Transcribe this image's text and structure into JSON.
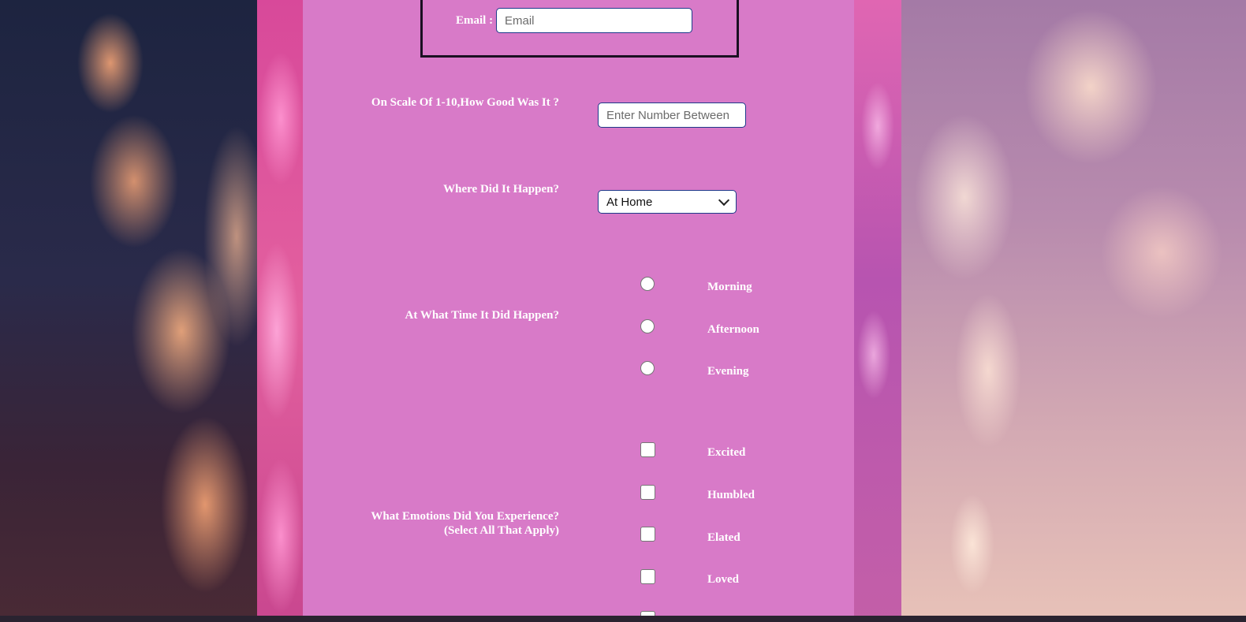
{
  "contact": {
    "email_label": "Email :",
    "email_placeholder": "Email"
  },
  "rating": {
    "label": "On Scale Of 1-10,How Good Was It ?",
    "placeholder": "Enter Number Between"
  },
  "location": {
    "label": "Where Did It Happen?",
    "selected": "At Home"
  },
  "time": {
    "label": "At What Time It Did Happen?",
    "options": [
      "Morning",
      "Afternoon",
      "Evening"
    ]
  },
  "emotions": {
    "label_line1": "What Emotions Did You Experience?",
    "label_line2": "(Select All That Apply)",
    "options": [
      "Excited",
      "Humbled",
      "Elated",
      "Loved"
    ]
  }
}
